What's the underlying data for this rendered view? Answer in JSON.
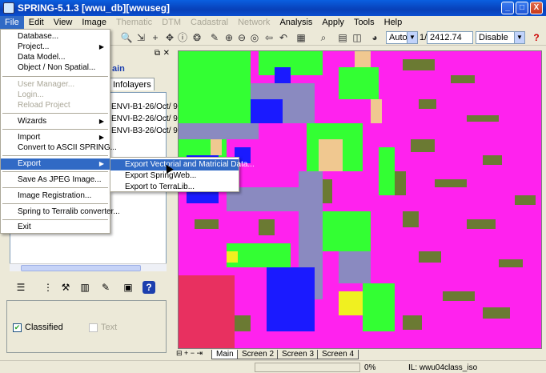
{
  "window": {
    "title": "SPRING-5.1.3 [wwu_db][wwuseg]",
    "controls": [
      "_",
      "□",
      "X"
    ]
  },
  "menubar": {
    "items": [
      {
        "label": "File",
        "state": "active"
      },
      {
        "label": "Edit",
        "state": "normal"
      },
      {
        "label": "View",
        "state": "normal"
      },
      {
        "label": "Image",
        "state": "normal"
      },
      {
        "label": "Thematic",
        "state": "disabled"
      },
      {
        "label": "DTM",
        "state": "disabled"
      },
      {
        "label": "Cadastral",
        "state": "disabled"
      },
      {
        "label": "Network",
        "state": "disabled"
      },
      {
        "label": "Analysis",
        "state": "normal"
      },
      {
        "label": "Apply",
        "state": "normal"
      },
      {
        "label": "Tools",
        "state": "normal"
      },
      {
        "label": "Help",
        "state": "normal"
      }
    ]
  },
  "toolbar": {
    "zoom_mode": "Auto",
    "scale_prefix": "1/",
    "scale_value": "2412.74",
    "mode_select": "Disable"
  },
  "file_menu": {
    "items": [
      {
        "label": "Database...",
        "state": "normal",
        "submenu": false
      },
      {
        "label": "Project...",
        "state": "normal",
        "submenu": true
      },
      {
        "label": "Data Model...",
        "state": "normal",
        "submenu": false
      },
      {
        "label": "Object / Non Spatial...",
        "state": "normal",
        "submenu": false
      },
      {
        "label": "User Manager...",
        "state": "disabled",
        "submenu": false
      },
      {
        "label": "Login...",
        "state": "disabled",
        "submenu": false
      },
      {
        "label": "Reload Project",
        "state": "disabled",
        "submenu": false
      },
      {
        "label": "Wizards",
        "state": "normal",
        "submenu": true
      },
      {
        "label": "Import",
        "state": "normal",
        "submenu": true
      },
      {
        "label": "Convert to ASCII SPRING...",
        "state": "normal",
        "submenu": false
      },
      {
        "label": "Export",
        "state": "highlighted",
        "submenu": true
      },
      {
        "label": "Save As JPEG Image...",
        "state": "normal",
        "submenu": false
      },
      {
        "label": "Image Registration...",
        "state": "normal",
        "submenu": false
      },
      {
        "label": "Spring to Terralib converter...",
        "state": "normal",
        "submenu": false
      },
      {
        "label": "Exit",
        "state": "normal",
        "submenu": false
      }
    ]
  },
  "export_submenu": {
    "items": [
      {
        "label": "Export Vectorial and Matricial Data...",
        "state": "highlighted"
      },
      {
        "label": "Export SpringWeb...",
        "state": "normal"
      },
      {
        "label": "Export to TerraLib...",
        "state": "normal"
      }
    ]
  },
  "left_panel": {
    "domain_label": "ain",
    "tab_label": "Infolayers",
    "tree_rows": [
      "ENVI-B1-26/Oct/ 9",
      "ENVI-B2-26/Oct/ 9",
      "ENVI-B3-26/Oct/ 9"
    ],
    "classified_label": "Classified",
    "text_label": "Text",
    "classified_checked": true,
    "text_checked": false
  },
  "screen_tabs": [
    "Main",
    "Screen 2",
    "Screen 3",
    "Screen 4"
  ],
  "statusbar": {
    "progress": "0%",
    "info": "IL: wwu04class_iso"
  },
  "colors": {
    "title_blue": "#0a4fd0",
    "menu_highlight": "#316ac5",
    "class_magenta": "#ff22ee",
    "class_green": "#33ff33",
    "class_blue": "#1a1aff",
    "class_olive": "#6b7a33",
    "class_tan": "#f0c890",
    "class_red": "#e83060",
    "class_yellow": "#f0f020",
    "class_gray": "#8a8ac0"
  }
}
